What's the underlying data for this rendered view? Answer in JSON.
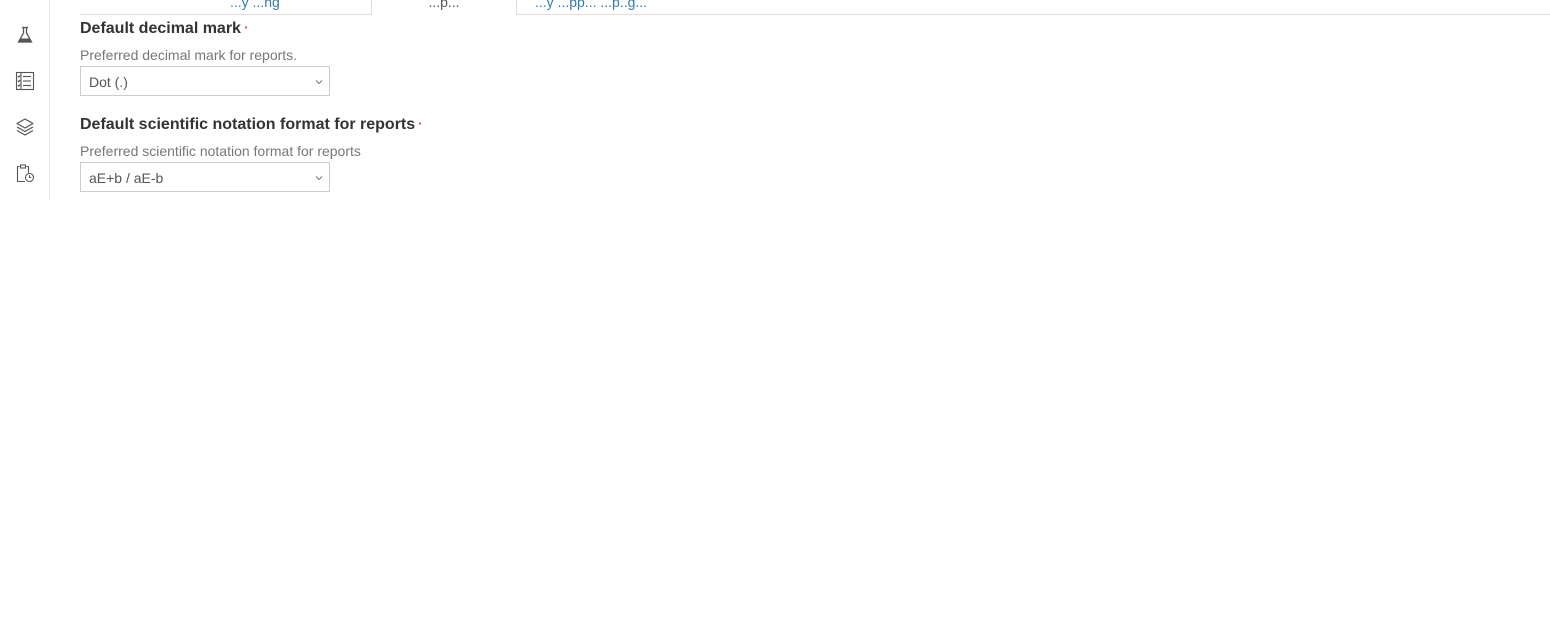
{
  "tabs": {
    "items": [
      {
        "label": "...y ...ng"
      },
      {
        "label": "...p..."
      },
      {
        "label": "...y ...pp... ...p..g..."
      }
    ]
  },
  "sidebar": {
    "icons": [
      "flask-icon",
      "checklist-icon",
      "layers-icon",
      "clipboard-clock-icon"
    ]
  },
  "fields": {
    "decimal_mark": {
      "label": "Default decimal mark",
      "required_mark": "·",
      "help": "Preferred decimal mark for reports.",
      "value": "Dot (.)"
    },
    "scientific_notation": {
      "label": "Default scientific notation format for reports",
      "required_mark": "·",
      "help": "Preferred scientific notation format for reports",
      "value": "aE+b / aE-b"
    }
  },
  "colors": {
    "link": "#337ab7",
    "required": "#d9534f",
    "border": "#cccccc"
  }
}
